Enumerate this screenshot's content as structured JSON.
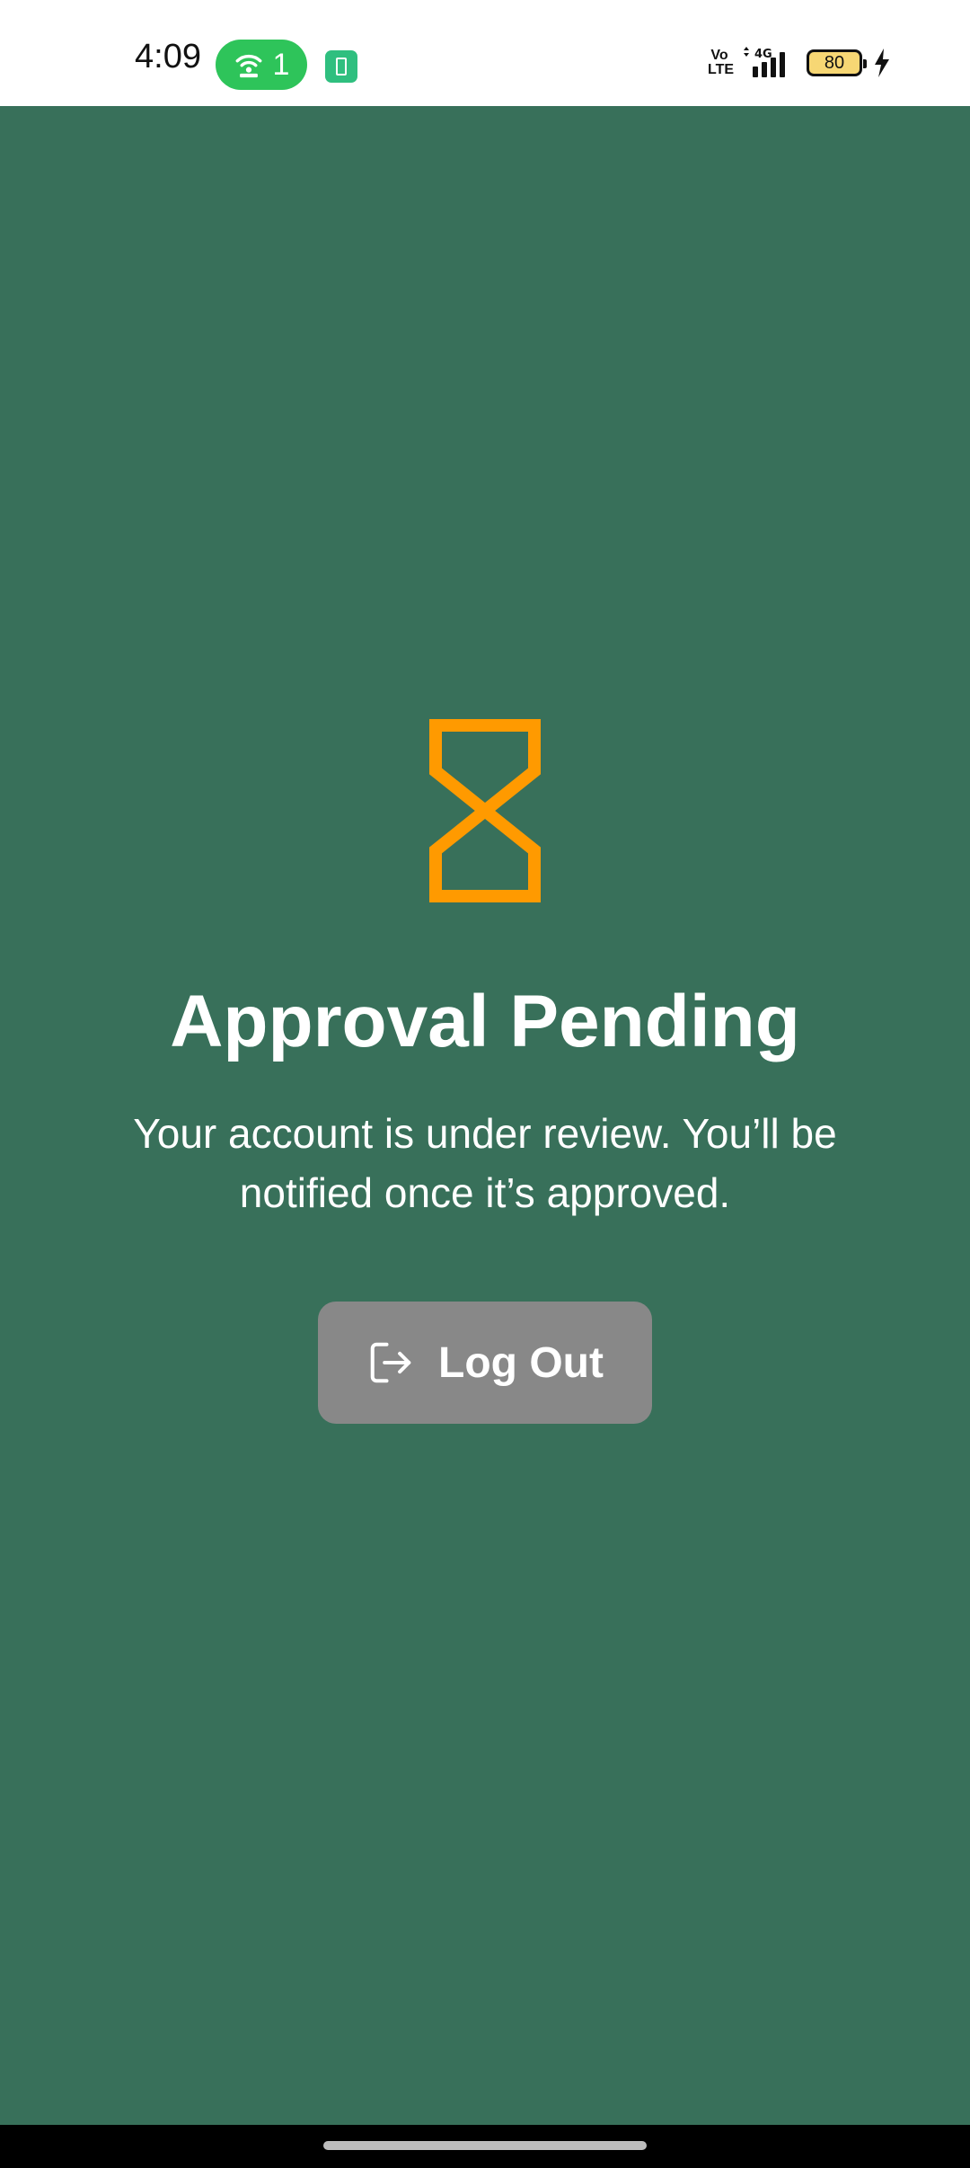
{
  "status_bar": {
    "time": "4:09",
    "hotspot_count": "1",
    "volte_line1": "Vo",
    "volte_line2": "LTE",
    "network": "4G",
    "battery_level": "80"
  },
  "main": {
    "title": "Approval Pending",
    "message": "Your account is under review. You’ll be notified once it’s approved.",
    "logout_label": "Log Out"
  },
  "colors": {
    "background": "#38705a",
    "accent": "#ff9a00",
    "button": "#888888",
    "text": "#ffffff"
  },
  "icons": {
    "status": "hourglass-icon",
    "logout": "logout-icon"
  }
}
